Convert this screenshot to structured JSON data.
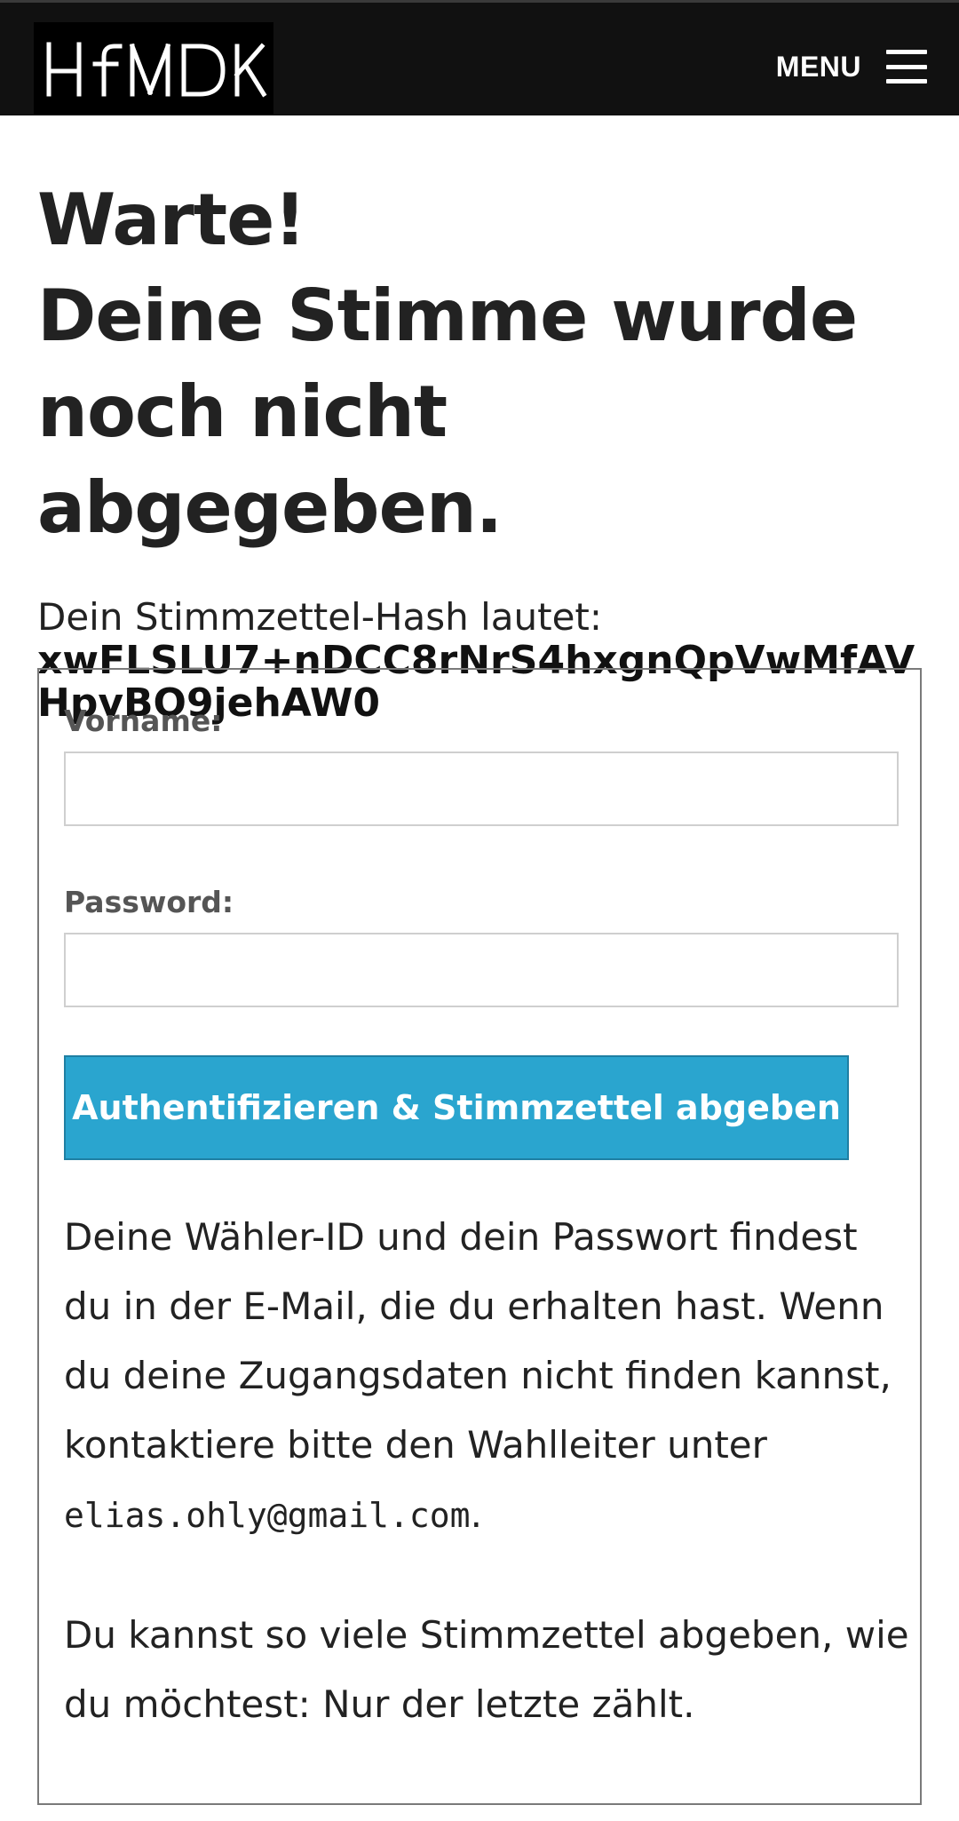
{
  "header": {
    "logo_text": "HfMDK",
    "menu_label": "MENU",
    "menu_icon": "hamburger-menu-icon"
  },
  "title": {
    "line1": "Warte!",
    "line2": "Deine Stimme wurde",
    "line3": "noch nicht abgegeben."
  },
  "hash": {
    "label": "Dein Stimmzettel-Hash lautet:",
    "value": "xwFLSLU7+nDCC8rNrS4hxgnQpVwMfAVHpvBO9jehAW0"
  },
  "form": {
    "first_name_label": "Vorname:",
    "first_name_value": "",
    "password_label": "Password:",
    "password_value": "",
    "submit_label": "Authentifizieren & Stimmzettel abgeben"
  },
  "help": {
    "text_before_email": "Deine Wähler-ID und dein Passwort findest du in der E-Mail, die du erhalten hast. Wenn du deine Zugangsdaten nicht finden kannst, kontaktiere bitte den Wahlleiter unter ",
    "email": "elias.ohly@gmail.com",
    "text_after_email": ".",
    "note": "Du kannst so viele Stimmzettel abgeben, wie du möchtest: Nur der letzte zählt."
  },
  "colors": {
    "header_bg": "#111111",
    "button_bg": "#2aa5cf",
    "text": "#222222"
  }
}
